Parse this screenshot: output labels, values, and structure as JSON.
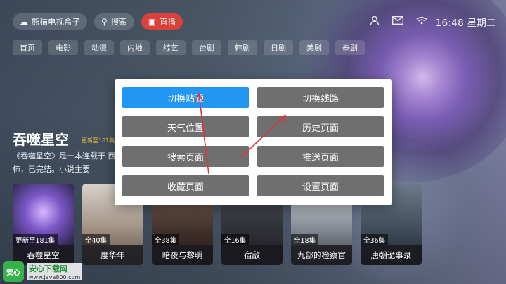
{
  "topbar": {
    "app_name": "熊猫电视盒子",
    "search_label": "搜索",
    "live_label": "直播",
    "clock": "16:48 星期二"
  },
  "tabs": [
    "首页",
    "电影",
    "动漫",
    "内地",
    "综艺",
    "台剧",
    "韩剧",
    "日剧",
    "美剧",
    "泰剧"
  ],
  "featured": {
    "title": "吞噬星空",
    "badge": "更新至181集",
    "description": "《吞噬星空》是一本连载于 西红柿，已完结。小说主要"
  },
  "posters": [
    {
      "episodes": "更新至181集",
      "title": "吞噬星空"
    },
    {
      "episodes": "全40集",
      "title": "度华年"
    },
    {
      "episodes": "全38集",
      "title": "暗夜与黎明"
    },
    {
      "episodes": "全16集",
      "title": "宿敌"
    },
    {
      "episodes": "全18集",
      "title": "九部的检察官"
    },
    {
      "episodes": "全36集",
      "title": "唐朝诡事录"
    }
  ],
  "menu": {
    "switch_source": "切换站源",
    "switch_line": "切换线路",
    "weather_location": "天气位置",
    "history_page": "历史页面",
    "search_page": "搜索页面",
    "push_page": "推送页面",
    "favorites_page": "收藏页面",
    "settings_page": "设置页面"
  },
  "watermark": {
    "logo_text": "安心",
    "site_name": "安心下载网",
    "url": "www.Java800.com"
  },
  "colors": {
    "active_button": "#2196f3",
    "menu_button": "#6f6f6f",
    "live_pill": "#d9413b",
    "annotation_arrow": "#e0343a"
  }
}
